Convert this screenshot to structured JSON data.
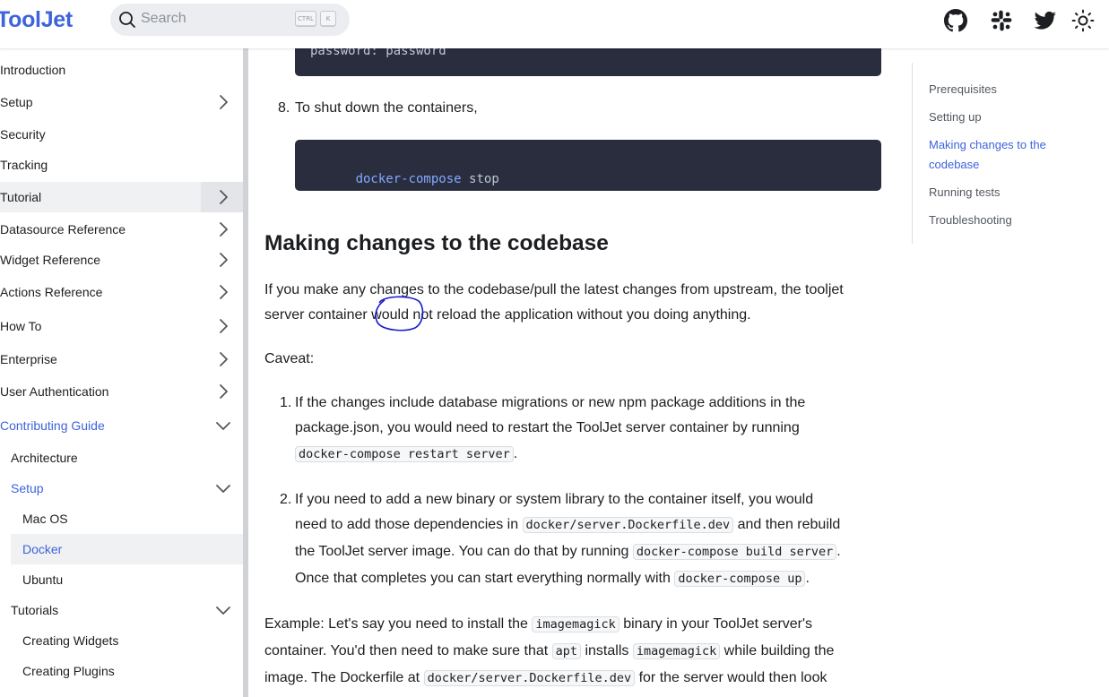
{
  "header": {
    "logo": "ToolJet",
    "search_placeholder": "Search",
    "kbd_ctrl": "CTRL",
    "kbd_k": "K",
    "icons": [
      "github-icon",
      "slack-icon",
      "twitter-icon",
      "theme-toggle-icon"
    ]
  },
  "sidebar": {
    "items": [
      {
        "label": "Introduction"
      },
      {
        "label": "Setup"
      },
      {
        "label": "Security"
      },
      {
        "label": "Tracking"
      },
      {
        "label": "Tutorial"
      },
      {
        "label": "Datasource Reference"
      },
      {
        "label": "Widget Reference"
      },
      {
        "label": "Actions Reference"
      },
      {
        "label": "How To"
      },
      {
        "label": "Enterprise"
      },
      {
        "label": "User Authentication"
      },
      {
        "label": "Contributing Guide"
      },
      {
        "label": "Architecture"
      },
      {
        "label": "Setup"
      },
      {
        "label": "Mac OS"
      },
      {
        "label": "Docker"
      },
      {
        "label": "Ubuntu"
      },
      {
        "label": "Tutorials"
      },
      {
        "label": "Creating Widgets"
      },
      {
        "label": "Creating Plugins"
      }
    ]
  },
  "content": {
    "code_top": "password: password",
    "step8_num": "8.",
    "step8_text": "To shut down the containers,",
    "code_stop_cmd": "docker-compose",
    "code_stop_arg": "stop",
    "heading": "Making changes to the codebase",
    "para1_line1": "If you make any changes to the codebase/pull the latest changes from upstream, the tooljet",
    "para1_line2_a": "server container ",
    "para1_line2_b": "would",
    "para1_line2_c": " not reload the application without you doing anything.",
    "caveat": "Caveat:",
    "item1_num": "1.",
    "item1_line1": "If the changes include database migrations or new npm package additions in the",
    "item1_line2": "package.json, you would need to restart the ToolJet server container by running",
    "item1_code": "docker-compose restart server",
    "item1_end": ".",
    "item2_num": "2.",
    "item2_line1": "If you need to add a new binary or system library to the container itself, you would",
    "item2_line2_a": "need to add those dependencies in ",
    "item2_code1": "docker/server.Dockerfile.dev",
    "item2_line2_b": " and then rebuild",
    "item2_line3_a": "the ToolJet server image. You can do that by running ",
    "item2_code2": "docker-compose build server",
    "item2_line3_b": ".",
    "item2_line4_a": "Once that completes you can start everything normally with ",
    "item2_code3": "docker-compose up",
    "item2_line4_b": ".",
    "ex_line1_a": "Example: Let's say you need to install the ",
    "ex_code1": "imagemagick",
    "ex_line1_b": " binary in your ToolJet server's",
    "ex_line2_a": "container. You'd then need to make sure that ",
    "ex_code2": "apt",
    "ex_line2_b": " installs ",
    "ex_code3": "imagemagick",
    "ex_line2_c": " while building the",
    "ex_line3_a": "image. The Dockerfile at ",
    "ex_code4": "docker/server.Dockerfile.dev",
    "ex_line3_b": " for the server would then look"
  },
  "toc": {
    "items": [
      {
        "label": "Prerequisites"
      },
      {
        "label": "Setting up"
      },
      {
        "label": "Making changes to the codebase"
      },
      {
        "label": "Running tests"
      },
      {
        "label": "Troubleshooting"
      }
    ]
  },
  "colors": {
    "accent": "#3e63dd",
    "code_bg": "#292d3e",
    "annotation": "#1a1acc"
  }
}
